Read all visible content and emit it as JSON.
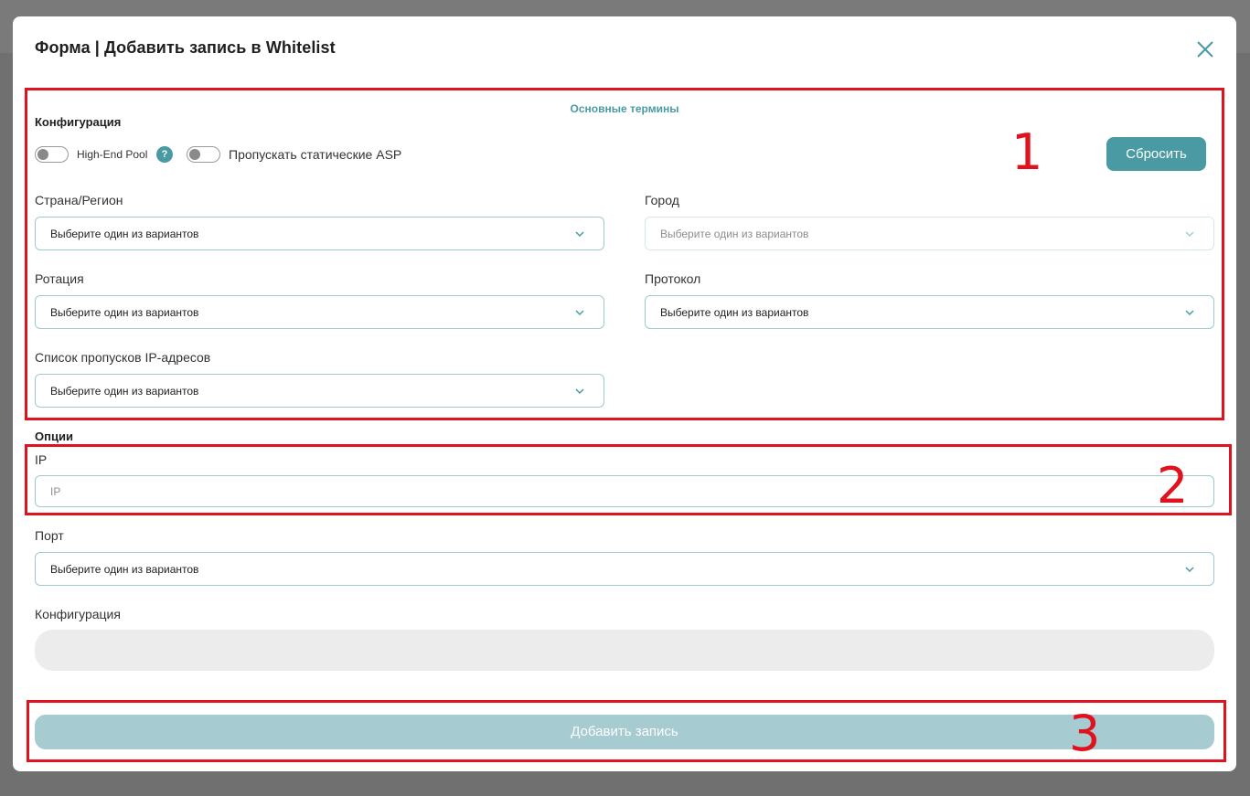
{
  "modal": {
    "title": "Форма | Добавить запись в Whitelist",
    "terms_link": "Основные термины"
  },
  "configuration": {
    "section_label": "Конфигурация",
    "toggles": [
      {
        "label": "High-End Pool",
        "on": false
      },
      {
        "label": "Пропускать статические ASP",
        "on": false
      }
    ],
    "help_icon_glyph": "?",
    "reset_label": "Сбросить",
    "fields": {
      "country": {
        "label": "Страна/Регион",
        "value": "Выберите один из вариантов"
      },
      "city": {
        "label": "Город",
        "value": "Выберите один из вариантов",
        "disabled": true
      },
      "rotation": {
        "label": "Ротация",
        "value": "Выберите один из вариантов"
      },
      "protocol": {
        "label": "Протокол",
        "value": "Выберите один из вариантов"
      },
      "ip_skip_list": {
        "label": "Список пропусков IP-адресов",
        "value": "Выберите один из вариантов"
      }
    }
  },
  "options": {
    "section_label": "Опции",
    "ip": {
      "label": "IP",
      "placeholder": "IP",
      "value": ""
    },
    "port": {
      "label": "Порт",
      "value": "Выберите один из вариантов"
    },
    "config_output": {
      "label": "Конфигурация",
      "value": ""
    }
  },
  "submit_label": "Добавить запись",
  "annotations": [
    "1",
    "2",
    "3"
  ],
  "colors": {
    "accent": "#4a9aa3",
    "submit_disabled": "#a6cbd1",
    "annotation": "#e0121e",
    "overlay": "#707070"
  }
}
